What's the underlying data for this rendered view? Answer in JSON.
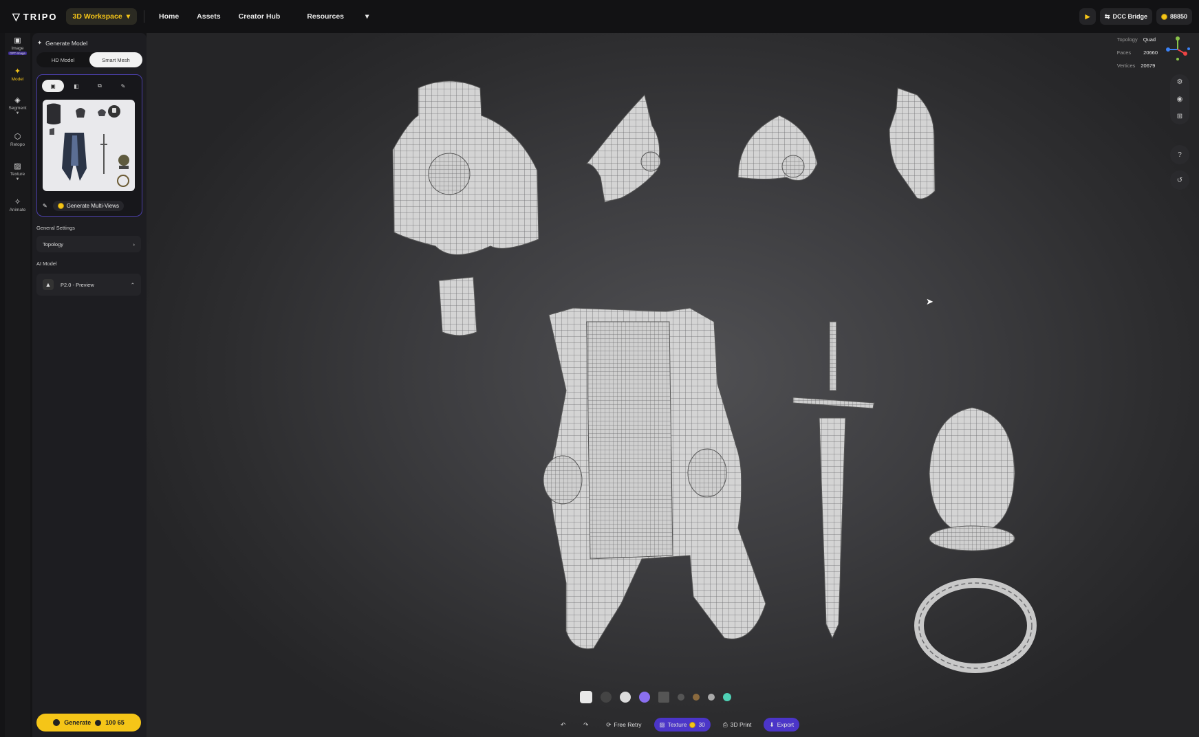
{
  "header": {
    "logo": "TRIPO",
    "workspace": "3D Workspace",
    "nav": [
      "Home",
      "Assets",
      "Creator Hub",
      "Resources"
    ],
    "dcc": "DCC Bridge",
    "credits": "88850"
  },
  "toolrail": {
    "items": [
      {
        "label": "Image",
        "badge": "GPT-Image"
      },
      {
        "label": "Model"
      },
      {
        "label": "Segment"
      },
      {
        "label": "Retopo"
      },
      {
        "label": "Texture"
      },
      {
        "label": "Animate"
      }
    ]
  },
  "panel": {
    "title": "Generate Model",
    "modes": [
      "HD Model",
      "Smart Mesh"
    ],
    "generate_multiviews": "Generate Multi-Views",
    "general_settings": "General Settings",
    "topology_label": "Topology",
    "ai_model_label": "AI Model",
    "ai_model_value": "P2.0 - Preview",
    "generate_label": "Generate",
    "generate_cost": "100 65"
  },
  "stats": {
    "topology_label": "Topology",
    "topology_value": "Quad",
    "faces_label": "Faces",
    "faces_value": "20660",
    "vertices_label": "Vertices",
    "vertices_value": "20679"
  },
  "bottom": {
    "free_retry": "Free Retry",
    "texture": "Texture",
    "texture_cost": "30",
    "print": "3D Print",
    "export": "Export"
  },
  "colors": {
    "accent": "#f5c518",
    "purple": "#4b35c8",
    "viewport": "#3d3d40"
  },
  "icons": [
    "undo-icon",
    "redo-icon",
    "grid-icon",
    "gear-icon",
    "camera-icon",
    "question-icon",
    "history-icon"
  ]
}
